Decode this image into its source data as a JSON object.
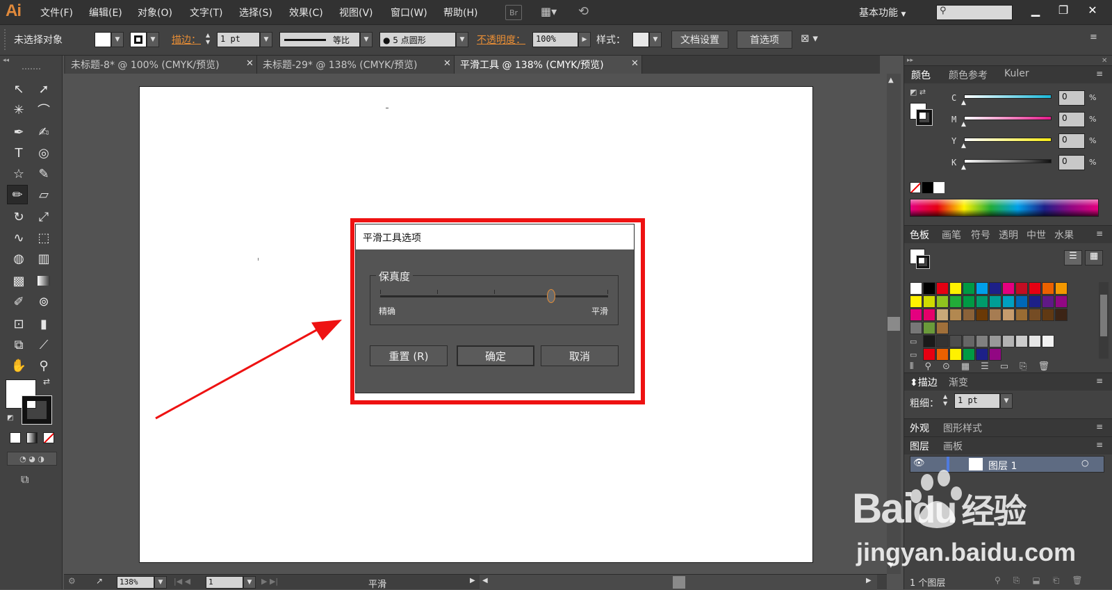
{
  "app": {
    "logo": "Ai"
  },
  "menu": [
    "文件(F)",
    "编辑(E)",
    "对象(O)",
    "文字(T)",
    "选择(S)",
    "效果(C)",
    "视图(V)",
    "窗口(W)",
    "帮助(H)"
  ],
  "menu_icons": {
    "bridge": "Br"
  },
  "workspace": "基本功能",
  "control_bar": {
    "selection": "未选择对象",
    "stroke_label": "描边：",
    "stroke_weight": "1 pt",
    "stroke_profile": "等比",
    "brush": "5 点圆形",
    "opacity_label": "不透明度：",
    "opacity_value": "100%",
    "style_label": "样式：",
    "doc_setup": "文档设置",
    "preferences": "首选项"
  },
  "tabs": [
    {
      "label": "未标题-8* @ 100% (CMYK/预览)"
    },
    {
      "label": "未标题-29* @ 138% (CMYK/预览)"
    },
    {
      "label": "平滑工具 @ 138% (CMYK/预览)"
    }
  ],
  "dialog": {
    "title": "平滑工具选项",
    "group_label": "保真度",
    "slider_min_label": "精确",
    "slider_max_label": "平滑",
    "slider_value_fraction": 0.75,
    "reset": "重置 (R)",
    "ok": "确定",
    "cancel": "取消"
  },
  "color_panel": {
    "tabs": [
      "颜色",
      "颜色参考",
      "Kuler"
    ],
    "channels": [
      {
        "name": "C",
        "value": "0",
        "color": "#19b8d9"
      },
      {
        "name": "M",
        "value": "0",
        "color": "#e5198a"
      },
      {
        "name": "Y",
        "value": "0",
        "color": "#f5ea14"
      },
      {
        "name": "K",
        "value": "0",
        "color": "#111111"
      }
    ],
    "unit": "%"
  },
  "swatch_panel": {
    "tabs": [
      "色板",
      "画笔",
      "符号",
      "透明",
      "中世",
      "水果"
    ],
    "colors": [
      "#ffffff",
      "#000000",
      "#e60012",
      "#fff100",
      "#009944",
      "#00a0e9",
      "#1d2088",
      "#e4007f",
      "#c30d23",
      "#e60012",
      "#eb6100",
      "#f39800",
      "#fff100",
      "#cfdb00",
      "#8fc31f",
      "#22ac38",
      "#009944",
      "#009b6b",
      "#009e96",
      "#00a0c1",
      "#0068b7",
      "#1d2088",
      "#601986",
      "#920783",
      "#e4007f",
      "#e5006a",
      "#c9a978",
      "#b28850",
      "#8a6239",
      "#6a3906",
      "#a67c52",
      "#c69c6d",
      "#996c33",
      "#754c24",
      "#603913",
      "#3c2415",
      "#1a1a1a",
      "#333333",
      "#4d4d4d",
      "#666666",
      "#808080",
      "#999999",
      "#b3b3b3",
      "#cccccc",
      "#e6e6e6",
      "#f2f2f2",
      "#e60012",
      "#eb6100",
      "#fff100",
      "#009944",
      "#1d2088",
      "#920783"
    ]
  },
  "stroke_panel": {
    "tabs": [
      "描边",
      "渐变"
    ],
    "weight_label": "粗细：",
    "weight": "1 pt"
  },
  "appearance_panel": {
    "tabs": [
      "外观",
      "图形样式"
    ]
  },
  "layers_panel": {
    "tabs": [
      "图层",
      "画板"
    ],
    "layer_name": "图层 1",
    "count": "1 个图层"
  },
  "status": {
    "zoom": "138%",
    "artboard": "1",
    "tool": "平滑"
  },
  "watermark": {
    "brand": "Bai",
    "brand_suffix": "经验",
    "url": "jingyan.baidu.com"
  },
  "colors": {
    "highlight": "#ee1212",
    "accent": "#e98e35",
    "arrow": "#ee1212"
  }
}
